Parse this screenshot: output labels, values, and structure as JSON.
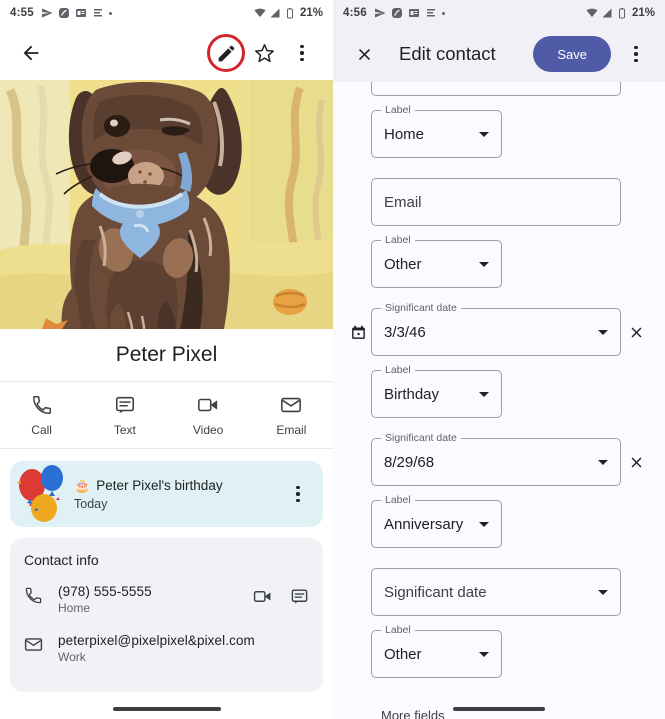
{
  "left": {
    "status": {
      "time": "4:55",
      "battery": "21%",
      "icons": [
        "send-icon",
        "app-icon",
        "card-icon",
        "list-icon",
        "dot-icon"
      ]
    },
    "appbar": {
      "back": "back-arrow-icon",
      "edit": "pencil-edit-icon",
      "favorite": "star-icon",
      "overflow": "more-vert-icon",
      "highlight_color": "#d1262b"
    },
    "photo": {
      "alt": "dachshund-portrait"
    },
    "contact_name": "Peter Pixel",
    "actions": [
      {
        "label": "Call",
        "icon": "phone-icon"
      },
      {
        "label": "Text",
        "icon": "message-icon"
      },
      {
        "label": "Video",
        "icon": "videocam-icon"
      },
      {
        "label": "Email",
        "icon": "envelope-icon"
      }
    ],
    "birthday_card": {
      "title": "Peter Pixel's birthday",
      "subtitle": "Today",
      "cake": "🎂",
      "bg": "#dff1f4",
      "overflow": "more-vert-icon"
    },
    "contact_info": {
      "title": "Contact info",
      "rows": [
        {
          "icon": "phone-icon",
          "value": "(978) 555-5555",
          "sub": "Home",
          "actions": [
            "videocam-icon",
            "message-icon"
          ]
        },
        {
          "icon": "envelope-icon",
          "value": "peterpixel@pixelpixel&pixel.com",
          "sub": "Work",
          "actions": []
        }
      ]
    }
  },
  "right": {
    "status": {
      "time": "4:56",
      "battery": "21%"
    },
    "appbar": {
      "close": "close-icon",
      "title": "Edit contact",
      "save_label": "Save",
      "save_color": "#4f5ba6",
      "overflow": "more-vert-icon"
    },
    "form": {
      "fields": [
        {
          "id": "phone-partial",
          "kind": "text",
          "label": "",
          "value": "",
          "width": "wide",
          "cutoff": true
        },
        {
          "id": "phone-label",
          "kind": "select",
          "label": "Label",
          "value": "Home",
          "width": "narrow"
        },
        {
          "id": "email",
          "kind": "text",
          "label": "",
          "value": "",
          "placeholder": "Email",
          "width": "wide"
        },
        {
          "id": "email-label",
          "kind": "select",
          "label": "Label",
          "value": "Other",
          "width": "narrow"
        },
        {
          "id": "sigdate-1",
          "kind": "select",
          "label": "Significant date",
          "value": "3/3/46",
          "width": "wide",
          "lead_icon": "calendar-icon",
          "removable": true
        },
        {
          "id": "sigdate-1-lbl",
          "kind": "select",
          "label": "Label",
          "value": "Birthday",
          "width": "narrow"
        },
        {
          "id": "sigdate-2",
          "kind": "select",
          "label": "Significant date",
          "value": "8/29/68",
          "width": "wide",
          "removable": true
        },
        {
          "id": "sigdate-2-lbl",
          "kind": "select",
          "label": "Label",
          "value": "Anniversary",
          "width": "narrow"
        },
        {
          "id": "sigdate-3",
          "kind": "select",
          "label": "",
          "value": "",
          "placeholder": "Significant date",
          "width": "wide"
        },
        {
          "id": "sigdate-3-lbl",
          "kind": "select",
          "label": "Label",
          "value": "Other",
          "width": "narrow"
        }
      ],
      "more_fields": "More fields"
    }
  }
}
